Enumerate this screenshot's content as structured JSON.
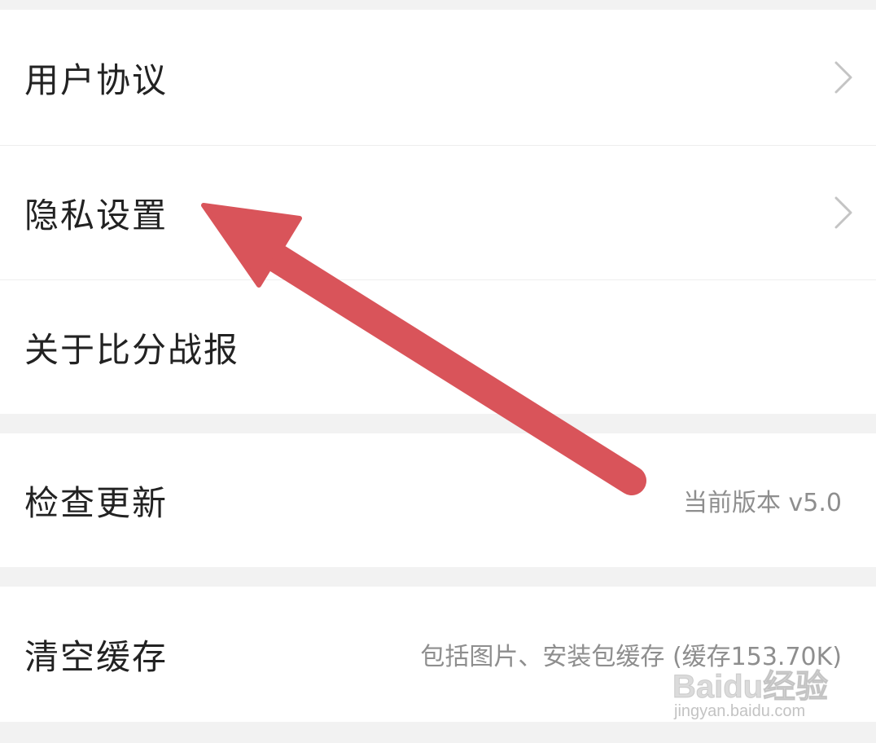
{
  "settings": {
    "items": [
      {
        "label": "用户协议",
        "has_chevron": true
      },
      {
        "label": "隐私设置",
        "has_chevron": true
      },
      {
        "label": "关于比分战报",
        "has_chevron": false
      }
    ],
    "update": {
      "label": "检查更新",
      "value": "当前版本 v5.0"
    },
    "cache": {
      "label": "清空缓存",
      "value": "包括图片、安装包缓存 (缓存153.70K)"
    }
  },
  "annotation": {
    "arrow_color": "#d9545a",
    "points_to": "隐私设置"
  },
  "watermark": {
    "logo": "Baidu经验",
    "url": "jingyan.baidu.com"
  },
  "icons": {
    "chevron": "chevron-right-icon",
    "arrow": "annotation-arrow-icon"
  }
}
